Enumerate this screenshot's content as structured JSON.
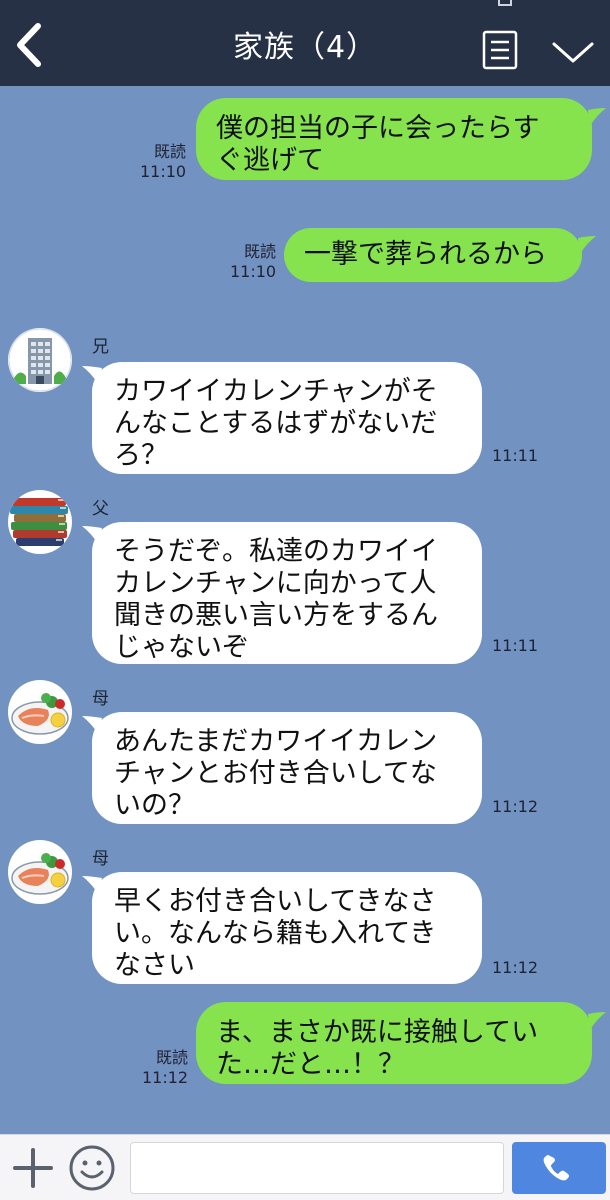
{
  "header": {
    "title": "家族（4）",
    "back_icon": "chevron-left-icon",
    "menu_icon": "notes-icon",
    "dropdown_icon": "chevron-down-icon"
  },
  "messages": [
    {
      "side": "out",
      "lines": [
        "僕の担当の子に会ったらす",
        "ぐ逃げて"
      ],
      "read": "既読",
      "time": "11:10"
    },
    {
      "side": "out",
      "lines": [
        "一撃で葬られるから"
      ],
      "read": "既読",
      "time": "11:10"
    },
    {
      "side": "in",
      "sender": "兄",
      "avatar": "building-avatar",
      "lines": [
        "カワイイカレンチャンがそ",
        "んなことするはずがないだ",
        "ろ？"
      ],
      "time": "11:11"
    },
    {
      "side": "in",
      "sender": "父",
      "avatar": "books-avatar",
      "lines": [
        "そうだぞ。私達のカワイイ",
        "カレンチャンに向かって人",
        "聞きの悪い言い方をするん",
        "じゃないぞ"
      ],
      "time": "11:11"
    },
    {
      "side": "in",
      "sender": "母",
      "avatar": "salmon-dish-avatar",
      "lines": [
        "あんたまだカワイイカレン",
        "チャンとお付き合いしてな",
        "いの？"
      ],
      "time": "11:12"
    },
    {
      "side": "in",
      "sender": "母",
      "avatar": "salmon-dish-avatar",
      "lines": [
        "早くお付き合いしてきなさ",
        "い。なんなら籍も入れてき",
        "なさい"
      ],
      "time": "11:12"
    },
    {
      "side": "out",
      "lines": [
        "ま、まさか既に接触してい",
        "た…だと…！？"
      ],
      "read": "既読",
      "time": "11:12"
    }
  ],
  "footer": {
    "plus_icon": "plus-icon",
    "emoji_icon": "smiley-icon",
    "input_placeholder": "",
    "call_icon": "phone-icon"
  },
  "colors": {
    "header_bg": "#263145",
    "chat_bg": "#7292c2",
    "outgoing_bubble": "#86e34e",
    "incoming_bubble": "#ffffff",
    "call_button": "#4f87e0"
  }
}
